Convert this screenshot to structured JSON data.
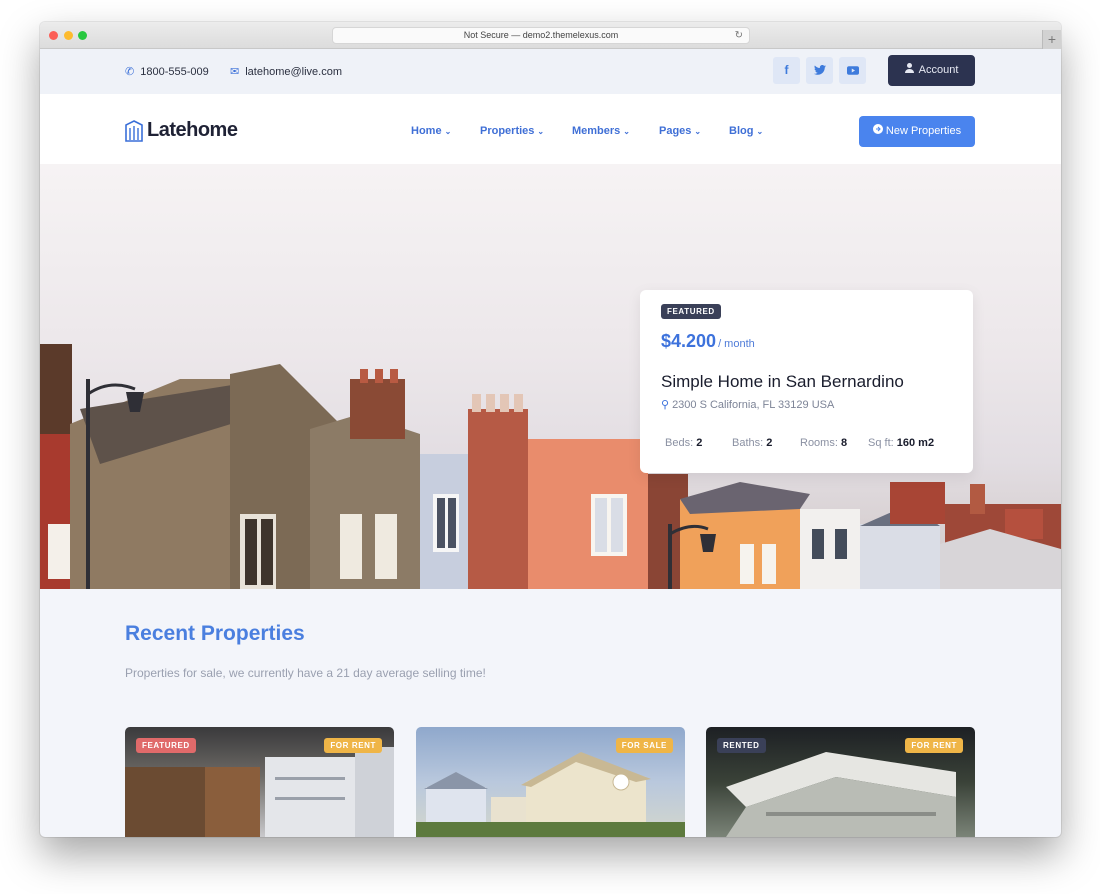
{
  "browser": {
    "url": "Not Secure — demo2.themelexus.com"
  },
  "topbar": {
    "phone": "1800-555-009",
    "email": "latehome@live.com",
    "social": [
      "f",
      "t",
      "yt"
    ],
    "account_label": "Account"
  },
  "nav": {
    "logo": "Latehome",
    "items": [
      {
        "label": "Home"
      },
      {
        "label": "Properties"
      },
      {
        "label": "Members"
      },
      {
        "label": "Pages"
      },
      {
        "label": "Blog"
      }
    ],
    "cta_label": "New Properties"
  },
  "featured": {
    "badge": "FEATURED",
    "price": "$4.200",
    "period": "/ month",
    "title": "Simple Home in San Bernardino",
    "address": "2300 S California, FL 33129 USA",
    "stats": [
      {
        "label": "Beds:",
        "value": "2"
      },
      {
        "label": "Baths:",
        "value": "2"
      },
      {
        "label": "Rooms:",
        "value": "8"
      },
      {
        "label": "Sq ft:",
        "value": "160 m2"
      }
    ]
  },
  "recent": {
    "title": "Recent Properties",
    "subtitle": "Properties for sale, we currently have a 21 day average selling time!",
    "cards": [
      {
        "left_badge": "FEATURED",
        "right_badge": "FOR RENT"
      },
      {
        "left_badge": "",
        "right_badge": "FOR SALE"
      },
      {
        "left_badge": "RENTED",
        "right_badge": "FOR RENT"
      }
    ]
  },
  "colors": {
    "accent": "#4a84ee",
    "dark": "#2c3350",
    "badge_featured": "#e06a6a",
    "badge_rent": "#efb547"
  }
}
